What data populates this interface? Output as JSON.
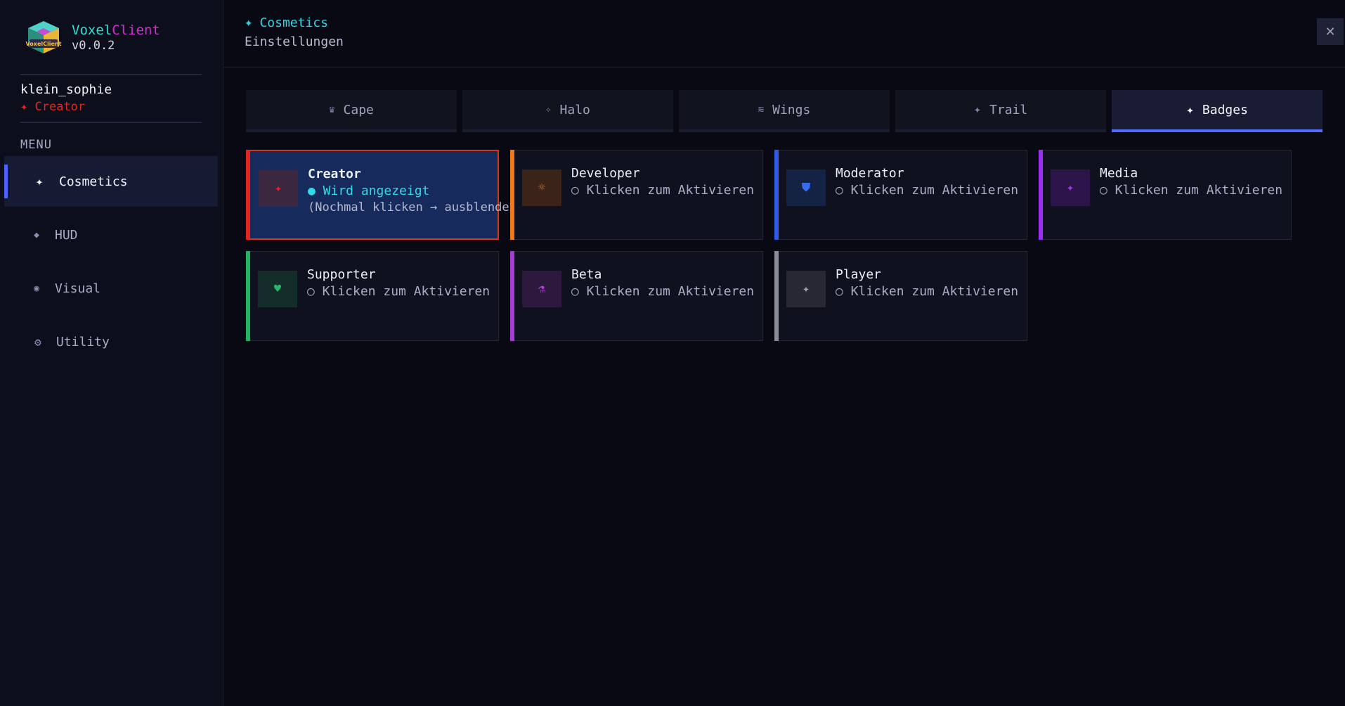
{
  "brand": {
    "name_part1": "Voxel",
    "name_part2": "Client",
    "version": "v0.0.2",
    "logo_text": "VoxelClient"
  },
  "user": {
    "name": "klein_sophie",
    "role": "✦ Creator"
  },
  "menu": {
    "label": "MENU",
    "items": [
      {
        "label": "Cosmetics",
        "icon": "sparkle-icon",
        "glyph": "✦",
        "active": true
      },
      {
        "label": "HUD",
        "icon": "diamond-icon",
        "glyph": "◆",
        "active": false
      },
      {
        "label": "Visual",
        "icon": "eye-icon",
        "glyph": "◉",
        "active": false
      },
      {
        "label": "Utility",
        "icon": "gear-icon",
        "glyph": "⚙",
        "active": false
      }
    ]
  },
  "header": {
    "crumb_icon": "✦",
    "title": "Cosmetics",
    "subtitle": "Einstellungen",
    "close": "✕"
  },
  "tabs": [
    {
      "label": "Cape",
      "glyph": "♛",
      "active": false
    },
    {
      "label": "Halo",
      "glyph": "✧",
      "active": false
    },
    {
      "label": "Wings",
      "glyph": "≋",
      "active": false
    },
    {
      "label": "Trail",
      "glyph": "✦",
      "active": false
    },
    {
      "label": "Badges",
      "glyph": "✦",
      "active": true
    }
  ],
  "badges": [
    {
      "title": "Creator",
      "status": "● Wird angezeigt",
      "hint": "(Nochmal klicken → ausblenden)",
      "glyph": "✦",
      "icon_color": "#e0261f",
      "icon_bg": "#3a2740",
      "accent": "#e0261f",
      "active": true
    },
    {
      "title": "Developer",
      "status": "○ Klicken zum Aktivieren",
      "glyph": "☼",
      "icon_color": "#e8731f",
      "icon_bg": "#3a2419",
      "accent": "#f07a1a",
      "active": false
    },
    {
      "title": "Moderator",
      "status": "○ Klicken zum Aktivieren",
      "glyph": "⛊",
      "icon_color": "#3a6cf0",
      "icon_bg": "#142244",
      "accent": "#2d5ce8",
      "active": false
    },
    {
      "title": "Media",
      "status": "○ Klicken zum Aktivieren",
      "glyph": "✦",
      "icon_color": "#a636f0",
      "icon_bg": "#2c1448",
      "accent": "#9a2ef0",
      "active": false
    },
    {
      "title": "Supporter",
      "status": "○ Klicken zum Aktivieren",
      "glyph": "♥",
      "icon_color": "#25b86a",
      "icon_bg": "#132e28",
      "accent": "#22b35f",
      "active": false
    },
    {
      "title": "Beta",
      "status": "○ Klicken zum Aktivieren",
      "glyph": "⚗",
      "icon_color": "#b13fd8",
      "icon_bg": "#2d183e",
      "accent": "#a43dd0",
      "active": false
    },
    {
      "title": "Player",
      "status": "○ Klicken zum Aktivieren",
      "glyph": "✦",
      "icon_color": "#9d9fae",
      "icon_bg": "#272833",
      "accent": "#8b8d99",
      "active": false
    }
  ]
}
